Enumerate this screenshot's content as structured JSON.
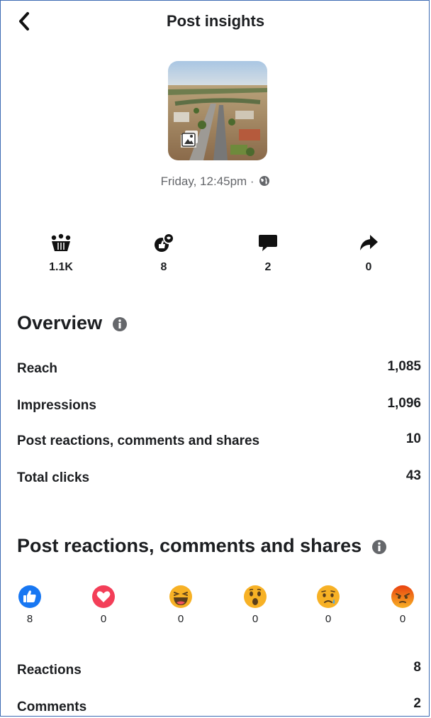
{
  "header": {
    "title": "Post insights",
    "back_icon": "chevron-left-icon"
  },
  "post": {
    "date": "Friday, 12:45pm ·",
    "privacy_icon": "globe-icon",
    "media_icon": "photo-album-icon"
  },
  "stats": [
    {
      "icon": "reach-icon",
      "value": "1.1K"
    },
    {
      "icon": "reactions-icon",
      "value": "8"
    },
    {
      "icon": "comment-icon",
      "value": "2"
    },
    {
      "icon": "share-icon",
      "value": "0"
    }
  ],
  "overview": {
    "title": "Overview",
    "rows": [
      {
        "label": "Reach",
        "value": "1,085"
      },
      {
        "label": "Impressions",
        "value": "1,096"
      },
      {
        "label": "Post reactions, comments and shares",
        "value": "10"
      },
      {
        "label": "Total clicks",
        "value": "43"
      }
    ]
  },
  "engagement": {
    "title": "Post reactions, comments and shares",
    "reactions": [
      {
        "icon": "like-icon",
        "count": "8",
        "color": "#1877f2"
      },
      {
        "icon": "love-icon",
        "count": "0",
        "color": "#f33e58"
      },
      {
        "icon": "haha-icon",
        "count": "0",
        "color": "#f7b125"
      },
      {
        "icon": "wow-icon",
        "count": "0",
        "color": "#f7b125"
      },
      {
        "icon": "sad-icon",
        "count": "0",
        "color": "#f7b125"
      },
      {
        "icon": "angry-icon",
        "count": "0",
        "color": "#e9710f"
      }
    ],
    "rows": [
      {
        "label": "Reactions",
        "value": "8"
      },
      {
        "label": "Comments",
        "value": "2"
      }
    ]
  }
}
